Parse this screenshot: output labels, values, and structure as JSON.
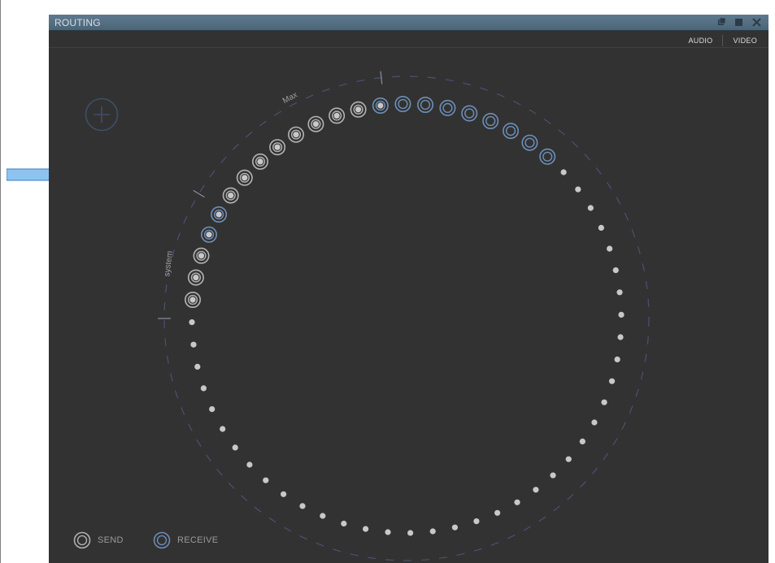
{
  "window": {
    "title": "ROUTING"
  },
  "tabs": [
    {
      "label": "AUDIO"
    },
    {
      "label": "VIDEO"
    }
  ],
  "ring_labels": {
    "max": "Max",
    "system": "system"
  },
  "legend": {
    "send": "SEND",
    "receive": "RECEIVE"
  },
  "colors": {
    "send": "#b4b4b4",
    "receive": "#6e8fb8",
    "dot": "#c8c8c8",
    "dash": "#4a5270",
    "titlebar": "#56708a",
    "background": "#323232",
    "arrow": "#8ec3f0"
  },
  "icons": {
    "add": "plus-circle-icon",
    "window_controls": [
      "detach-icon",
      "maximize-icon",
      "close-icon"
    ],
    "pointer": "arrow-right-icon"
  },
  "ports": {
    "system_send_count": 3,
    "system_receive_count": 2,
    "max_send_count": 8,
    "max_receive_count": 9,
    "empty_slot_count": 52
  }
}
